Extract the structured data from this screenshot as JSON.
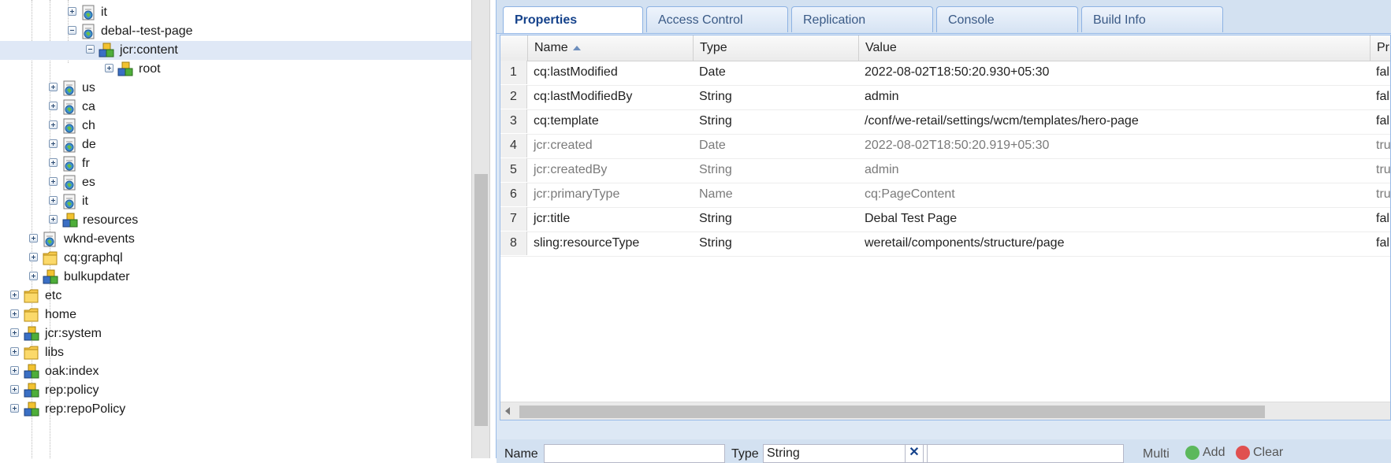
{
  "tree": {
    "nodes": [
      {
        "label": "it"
      },
      {
        "label": "debal--test-page"
      },
      {
        "label": "jcr:content"
      },
      {
        "label": "root"
      },
      {
        "label": "us"
      },
      {
        "label": "ca"
      },
      {
        "label": "ch"
      },
      {
        "label": "de"
      },
      {
        "label": "fr"
      },
      {
        "label": "es"
      },
      {
        "label": "it"
      },
      {
        "label": "resources"
      },
      {
        "label": "wknd-events"
      },
      {
        "label": "cq:graphql"
      },
      {
        "label": "bulkupdater"
      },
      {
        "label": "etc"
      },
      {
        "label": "home"
      },
      {
        "label": "jcr:system"
      },
      {
        "label": "libs"
      },
      {
        "label": "oak:index"
      },
      {
        "label": "rep:policy"
      },
      {
        "label": "rep:repoPolicy"
      }
    ]
  },
  "tabs": [
    "Properties",
    "Access Control",
    "Replication",
    "Console",
    "Build Info"
  ],
  "grid": {
    "headers": {
      "num": "",
      "name": "Name",
      "type": "Type",
      "value": "Value",
      "protected": "Pr"
    },
    "rows": [
      {
        "num": "1",
        "name": "cq:lastModified",
        "type": "Date",
        "value": "2022-08-02T18:50:20.930+05:30",
        "protected": "fal"
      },
      {
        "num": "2",
        "name": "cq:lastModifiedBy",
        "type": "String",
        "value": "admin",
        "protected": "fal"
      },
      {
        "num": "3",
        "name": "cq:template",
        "type": "String",
        "value": "/conf/we-retail/settings/wcm/templates/hero-page",
        "protected": "fal"
      },
      {
        "num": "4",
        "name": "jcr:created",
        "type": "Date",
        "value": "2022-08-02T18:50:20.919+05:30",
        "protected": "tru"
      },
      {
        "num": "5",
        "name": "jcr:createdBy",
        "type": "String",
        "value": "admin",
        "protected": "tru"
      },
      {
        "num": "6",
        "name": "jcr:primaryType",
        "type": "Name",
        "value": "cq:PageContent",
        "protected": "tru"
      },
      {
        "num": "7",
        "name": "jcr:title",
        "type": "String",
        "value": "Debal Test Page",
        "protected": "fal"
      },
      {
        "num": "8",
        "name": "sling:resourceType",
        "type": "String",
        "value": "weretail/components/structure/page",
        "protected": "fal"
      }
    ]
  },
  "form": {
    "name_label": "Name",
    "type_label": "Type",
    "type_value": "String",
    "multi_label": "Multi",
    "add_label": "Add",
    "clear_label": "Clear"
  }
}
